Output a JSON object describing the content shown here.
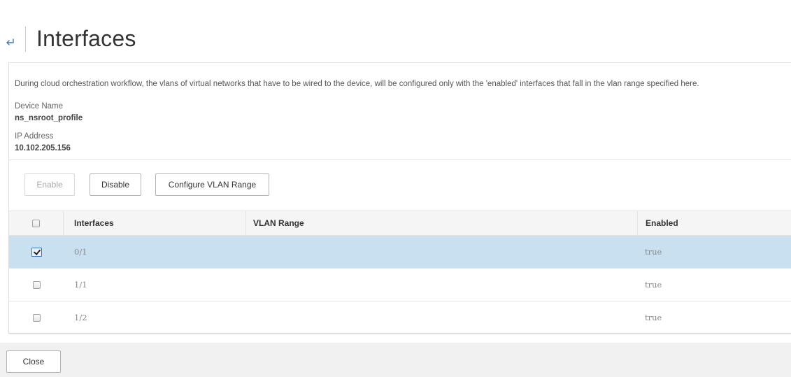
{
  "header": {
    "back_icon": "back-arrow-icon",
    "title": "Interfaces"
  },
  "info": {
    "description": "During cloud orchestration workflow, the vlans of virtual networks that have to be wired to the device, will be configured only with the 'enabled' interfaces that fall in the vlan range specified here.",
    "device_name_label": "Device Name",
    "device_name_value": "ns_nsroot_profile",
    "ip_label": "IP Address",
    "ip_value": "10.102.205.156"
  },
  "toolbar": {
    "enable_label": "Enable",
    "enable_disabled": true,
    "disable_label": "Disable",
    "configure_label": "Configure VLAN Range"
  },
  "table": {
    "columns": [
      "Interfaces",
      "VLAN Range",
      "Enabled"
    ],
    "rows": [
      {
        "interface": "0/1",
        "vlan_range": "",
        "enabled": "true",
        "checked": true
      },
      {
        "interface": "1/1",
        "vlan_range": "",
        "enabled": "true",
        "checked": false
      },
      {
        "interface": "1/2",
        "vlan_range": "",
        "enabled": "true",
        "checked": false
      }
    ]
  },
  "footer": {
    "close_label": "Close"
  },
  "colors": {
    "accent": "#3a7bbf",
    "selected_row": "#c9e0f0",
    "footer_bg": "#f0f0f0"
  }
}
